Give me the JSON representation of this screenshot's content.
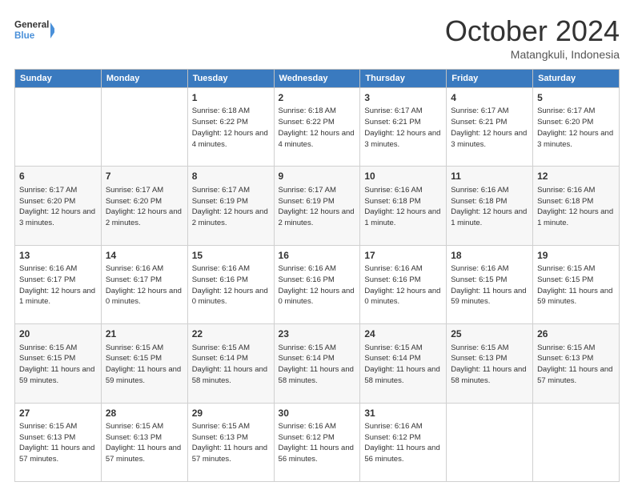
{
  "header": {
    "logo_general": "General",
    "logo_blue": "Blue",
    "month": "October 2024",
    "location": "Matangkuli, Indonesia"
  },
  "days_of_week": [
    "Sunday",
    "Monday",
    "Tuesday",
    "Wednesday",
    "Thursday",
    "Friday",
    "Saturday"
  ],
  "weeks": [
    [
      {
        "day": "",
        "info": ""
      },
      {
        "day": "",
        "info": ""
      },
      {
        "day": "1",
        "info": "Sunrise: 6:18 AM\nSunset: 6:22 PM\nDaylight: 12 hours and 4 minutes."
      },
      {
        "day": "2",
        "info": "Sunrise: 6:18 AM\nSunset: 6:22 PM\nDaylight: 12 hours and 4 minutes."
      },
      {
        "day": "3",
        "info": "Sunrise: 6:17 AM\nSunset: 6:21 PM\nDaylight: 12 hours and 3 minutes."
      },
      {
        "day": "4",
        "info": "Sunrise: 6:17 AM\nSunset: 6:21 PM\nDaylight: 12 hours and 3 minutes."
      },
      {
        "day": "5",
        "info": "Sunrise: 6:17 AM\nSunset: 6:20 PM\nDaylight: 12 hours and 3 minutes."
      }
    ],
    [
      {
        "day": "6",
        "info": "Sunrise: 6:17 AM\nSunset: 6:20 PM\nDaylight: 12 hours and 3 minutes."
      },
      {
        "day": "7",
        "info": "Sunrise: 6:17 AM\nSunset: 6:20 PM\nDaylight: 12 hours and 2 minutes."
      },
      {
        "day": "8",
        "info": "Sunrise: 6:17 AM\nSunset: 6:19 PM\nDaylight: 12 hours and 2 minutes."
      },
      {
        "day": "9",
        "info": "Sunrise: 6:17 AM\nSunset: 6:19 PM\nDaylight: 12 hours and 2 minutes."
      },
      {
        "day": "10",
        "info": "Sunrise: 6:16 AM\nSunset: 6:18 PM\nDaylight: 12 hours and 1 minute."
      },
      {
        "day": "11",
        "info": "Sunrise: 6:16 AM\nSunset: 6:18 PM\nDaylight: 12 hours and 1 minute."
      },
      {
        "day": "12",
        "info": "Sunrise: 6:16 AM\nSunset: 6:18 PM\nDaylight: 12 hours and 1 minute."
      }
    ],
    [
      {
        "day": "13",
        "info": "Sunrise: 6:16 AM\nSunset: 6:17 PM\nDaylight: 12 hours and 1 minute."
      },
      {
        "day": "14",
        "info": "Sunrise: 6:16 AM\nSunset: 6:17 PM\nDaylight: 12 hours and 0 minutes."
      },
      {
        "day": "15",
        "info": "Sunrise: 6:16 AM\nSunset: 6:16 PM\nDaylight: 12 hours and 0 minutes."
      },
      {
        "day": "16",
        "info": "Sunrise: 6:16 AM\nSunset: 6:16 PM\nDaylight: 12 hours and 0 minutes."
      },
      {
        "day": "17",
        "info": "Sunrise: 6:16 AM\nSunset: 6:16 PM\nDaylight: 12 hours and 0 minutes."
      },
      {
        "day": "18",
        "info": "Sunrise: 6:16 AM\nSunset: 6:15 PM\nDaylight: 11 hours and 59 minutes."
      },
      {
        "day": "19",
        "info": "Sunrise: 6:15 AM\nSunset: 6:15 PM\nDaylight: 11 hours and 59 minutes."
      }
    ],
    [
      {
        "day": "20",
        "info": "Sunrise: 6:15 AM\nSunset: 6:15 PM\nDaylight: 11 hours and 59 minutes."
      },
      {
        "day": "21",
        "info": "Sunrise: 6:15 AM\nSunset: 6:15 PM\nDaylight: 11 hours and 59 minutes."
      },
      {
        "day": "22",
        "info": "Sunrise: 6:15 AM\nSunset: 6:14 PM\nDaylight: 11 hours and 58 minutes."
      },
      {
        "day": "23",
        "info": "Sunrise: 6:15 AM\nSunset: 6:14 PM\nDaylight: 11 hours and 58 minutes."
      },
      {
        "day": "24",
        "info": "Sunrise: 6:15 AM\nSunset: 6:14 PM\nDaylight: 11 hours and 58 minutes."
      },
      {
        "day": "25",
        "info": "Sunrise: 6:15 AM\nSunset: 6:13 PM\nDaylight: 11 hours and 58 minutes."
      },
      {
        "day": "26",
        "info": "Sunrise: 6:15 AM\nSunset: 6:13 PM\nDaylight: 11 hours and 57 minutes."
      }
    ],
    [
      {
        "day": "27",
        "info": "Sunrise: 6:15 AM\nSunset: 6:13 PM\nDaylight: 11 hours and 57 minutes."
      },
      {
        "day": "28",
        "info": "Sunrise: 6:15 AM\nSunset: 6:13 PM\nDaylight: 11 hours and 57 minutes."
      },
      {
        "day": "29",
        "info": "Sunrise: 6:15 AM\nSunset: 6:13 PM\nDaylight: 11 hours and 57 minutes."
      },
      {
        "day": "30",
        "info": "Sunrise: 6:16 AM\nSunset: 6:12 PM\nDaylight: 11 hours and 56 minutes."
      },
      {
        "day": "31",
        "info": "Sunrise: 6:16 AM\nSunset: 6:12 PM\nDaylight: 11 hours and 56 minutes."
      },
      {
        "day": "",
        "info": ""
      },
      {
        "day": "",
        "info": ""
      }
    ]
  ]
}
